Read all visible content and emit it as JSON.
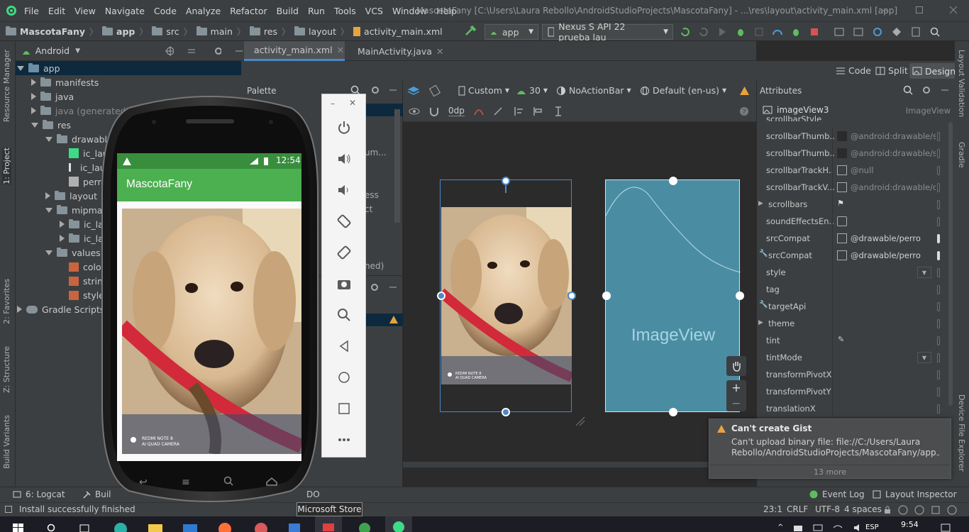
{
  "titlebar": {
    "menu": [
      "File",
      "Edit",
      "View",
      "Navigate",
      "Code",
      "Analyze",
      "Refactor",
      "Build",
      "Run",
      "Tools",
      "VCS",
      "Window",
      "Help"
    ],
    "title": "MascotaFany [C:\\Users\\Laura Rebollo\\AndroidStudioProjects\\MascotaFany] - ...\\res\\layout\\activity_main.xml [app]"
  },
  "navbar": {
    "crumbs": [
      "MascotaFany",
      "app",
      "src",
      "main",
      "res",
      "layout",
      "activity_main.xml"
    ],
    "run_config": "app",
    "device": "Nexus S API 22 prueba lau"
  },
  "project_panel": {
    "view_mode": "Android",
    "tree": [
      {
        "label": "app",
        "level": 0,
        "open": true,
        "icon": "folder-module-icon"
      },
      {
        "label": "manifests",
        "level": 1,
        "open": false,
        "icon": "folder-icon"
      },
      {
        "label": "java",
        "level": 1,
        "open": false,
        "icon": "folder-icon"
      },
      {
        "label": "java (generated)",
        "level": 1,
        "open": false,
        "icon": "folder-icon"
      },
      {
        "label": "res",
        "level": 1,
        "open": true,
        "icon": "folder-icon"
      },
      {
        "label": "drawable",
        "level": 2,
        "open": true,
        "icon": "folder-icon"
      },
      {
        "label": "ic_lau",
        "level": 3,
        "leaf": true,
        "icon": "image-icon"
      },
      {
        "label": "ic_lau",
        "level": 3,
        "leaf": true,
        "icon": "vector-icon"
      },
      {
        "label": "perro",
        "level": 3,
        "leaf": true,
        "icon": "image-icon"
      },
      {
        "label": "layout",
        "level": 2,
        "open": false,
        "icon": "folder-icon"
      },
      {
        "label": "mipmap",
        "level": 2,
        "open": true,
        "icon": "folder-icon"
      },
      {
        "label": "ic_la",
        "level": 3,
        "open": false,
        "icon": "folder-icon"
      },
      {
        "label": "ic_la",
        "level": 3,
        "open": false,
        "icon": "folder-icon"
      },
      {
        "label": "values",
        "level": 2,
        "open": true,
        "icon": "folder-icon"
      },
      {
        "label": "colo",
        "level": 3,
        "leaf": true,
        "icon": "xml-icon"
      },
      {
        "label": "string",
        "level": 3,
        "leaf": true,
        "icon": "xml-icon"
      },
      {
        "label": "styles",
        "level": 3,
        "leaf": true,
        "icon": "xml-icon"
      },
      {
        "label": "Gradle Scripts",
        "level": 0,
        "open": false,
        "icon": "gradle-icon"
      }
    ]
  },
  "left_strip": {
    "tabs": [
      "Resource Manager",
      "1: Project",
      "2: Favorites",
      "Z: Structure",
      "Build Variants"
    ]
  },
  "editor_tabs": [
    {
      "label": "activity_main.xml",
      "active": true
    },
    {
      "label": "MainActivity.java",
      "active": false
    }
  ],
  "view_modes": [
    "Code",
    "Split",
    "Design"
  ],
  "palette": {
    "title": "Palette",
    "partial_texts": [
      "Ab",
      "um...",
      "ess",
      "ct",
      "ned)"
    ]
  },
  "design_toolbar": {
    "device": "Custom",
    "api": "30",
    "theme": "NoActionBar",
    "locale": "Default (en-us)",
    "margin": "0dp"
  },
  "canvas": {
    "blueprint_label": "ImageView",
    "watermark": "REDMI NOTE 8\nAI QUAD CAMERA",
    "zoom_plus": "+",
    "zoom_minus": "−"
  },
  "attributes": {
    "title": "Attributes",
    "component_id": "imageView3",
    "component_type": "ImageView",
    "partial_top": "scrollbarStyle",
    "rows": [
      {
        "name": "scrollbarThumb...",
        "value": "@android:drawable/sc"
      },
      {
        "name": "scrollbarThumb...",
        "value": "@android:drawable/sc"
      },
      {
        "name": "scrollbarTrackH...",
        "value": "@null"
      },
      {
        "name": "scrollbarTrackV...",
        "value": "@android:drawable/c"
      },
      {
        "name": "scrollbars",
        "value": ""
      },
      {
        "name": "soundEffectsEn...",
        "value": ""
      },
      {
        "name": "srcCompat",
        "value": "@drawable/perro"
      },
      {
        "name": "srcCompat",
        "value": "@drawable/perro"
      },
      {
        "name": "style",
        "value": ""
      },
      {
        "name": "tag",
        "value": ""
      },
      {
        "name": "targetApi",
        "value": ""
      },
      {
        "name": "theme",
        "value": ""
      },
      {
        "name": "tint",
        "value": ""
      },
      {
        "name": "tintMode",
        "value": ""
      },
      {
        "name": "transformPivotX",
        "value": ""
      },
      {
        "name": "transformPivotY",
        "value": ""
      },
      {
        "name": "translationX",
        "value": ""
      }
    ]
  },
  "right_strip": {
    "tabs": [
      "Layout Validation",
      "Gradle",
      "Device File Explorer"
    ]
  },
  "notification": {
    "title": "Can't create Gist",
    "body": "Can't upload binary file: file://C:/Users/Laura Rebollo/AndroidStudioProjects/MascotaFany/app.",
    "more": "13 more"
  },
  "bottom_tools": {
    "left": [
      "6: Logcat",
      "Buil",
      "DO"
    ],
    "right": [
      "Event Log",
      "Layout Inspector"
    ]
  },
  "status": {
    "message": "Install successfully finished",
    "position": "23:1",
    "line_sep": "CRLF",
    "encoding": "UTF-8",
    "indent": "4 spaces"
  },
  "tooltip": "Microsoft Store",
  "phone": {
    "status_time": "12:54",
    "app_title": "MascotaFany",
    "watermark": "REDMI NOTE 8\nAI QUAD CAMERA"
  },
  "taskbar": {
    "lang": "ESP",
    "time": "9:54"
  },
  "colors": {
    "accent_blue": "#4a88c7",
    "app_bar_green": "#4caf50",
    "status_bar_green": "#388e3c",
    "blueprint": "#4a8da3",
    "warning": "#e8a33e"
  }
}
